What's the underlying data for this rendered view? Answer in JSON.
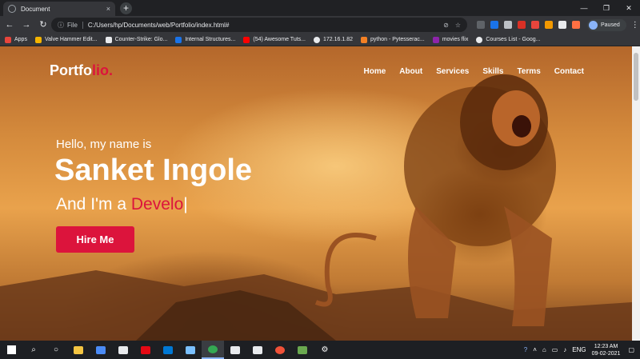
{
  "browser": {
    "tab_title": "Document",
    "tab_close": "×",
    "new_tab": "+",
    "window_controls": [
      "—",
      "❐",
      "✕"
    ],
    "nav": {
      "back": "←",
      "forward": "→",
      "reload": "↻"
    },
    "omnibox": {
      "security_icon": "ⓘ",
      "scheme_label": "File",
      "url": "C:/Users/hp/Documents/web/Portfolio/index.html#"
    },
    "profile_status": "Paused",
    "menu_icon": "⋮",
    "extensions": [
      {
        "icon": "extension-icon",
        "color": "#5f6368"
      },
      {
        "icon": "extension-icon",
        "color": "#1a73e8"
      },
      {
        "icon": "extension-icon",
        "color": "#bdc1c6"
      },
      {
        "icon": "extension-icon",
        "color": "#d93025"
      },
      {
        "icon": "extension-icon",
        "color": "#e8453c"
      },
      {
        "icon": "extension-icon",
        "color": "#f29900"
      },
      {
        "icon": "puzzle-icon",
        "color": "#e8eaed"
      },
      {
        "icon": "extension-icon",
        "color": "#ff7043"
      }
    ]
  },
  "bookmarks": [
    {
      "label": "Apps",
      "color": "#e8453c"
    },
    {
      "label": "Valve Hammer Edit...",
      "color": "#f4b400"
    },
    {
      "label": "Counter-Strike: Glo...",
      "color": "#e8eaed"
    },
    {
      "label": "Internal Structures...",
      "color": "#1a73e8"
    },
    {
      "label": "(54) Awesome Tuts...",
      "color": "#ff0000"
    },
    {
      "label": "172.16.1.82",
      "color": "#e8eaed"
    },
    {
      "label": "python - Pytesserac...",
      "color": "#f48024"
    },
    {
      "label": "movies flix",
      "color": "#8e24aa"
    },
    {
      "label": "Courses List - Goog...",
      "color": "#e8eaed"
    }
  ],
  "site": {
    "logo_main": "Portfo",
    "logo_accent": "lio.",
    "nav": [
      "Home",
      "About",
      "Services",
      "Skills",
      "Terms",
      "Contact"
    ],
    "hero": {
      "greeting": "Hello, my name is",
      "name": "Sanket Ingole",
      "role_prefix": "And I'm a ",
      "role_typed": "Develo",
      "cursor": "|",
      "cta": "Hire Me"
    },
    "colors": {
      "accent": "#dc143c",
      "text": "#ffffff"
    }
  },
  "taskbar": {
    "apps": [
      {
        "icon": "windows-icon",
        "color": "#ffffff"
      },
      {
        "icon": "search-icon",
        "color": "#ffffff"
      },
      {
        "icon": "task-view-icon",
        "color": "#ffffff"
      },
      {
        "icon": "file-explorer-icon",
        "color": "#f4c542"
      },
      {
        "icon": "store-icon",
        "color": "#4b8bf5"
      },
      {
        "icon": "dropbox-icon",
        "color": "#e8eaed"
      },
      {
        "icon": "netflix-icon",
        "color": "#e50914"
      },
      {
        "icon": "mail-icon",
        "color": "#0078d4"
      },
      {
        "icon": "paint-icon",
        "color": "#7ac0ff"
      },
      {
        "icon": "chrome-icon",
        "color": "#34a853"
      },
      {
        "icon": "photos-icon",
        "color": "#e8eaed"
      },
      {
        "icon": "vscode-icon",
        "color": "#e8eaed"
      },
      {
        "icon": "swift-icon",
        "color": "#f05138"
      },
      {
        "icon": "minecraft-icon",
        "color": "#6aa84f"
      },
      {
        "icon": "settings-icon",
        "color": "#ffffff"
      }
    ],
    "tray": {
      "language": "ENG",
      "time": "12:23 AM",
      "date": "09-02-2021"
    }
  }
}
